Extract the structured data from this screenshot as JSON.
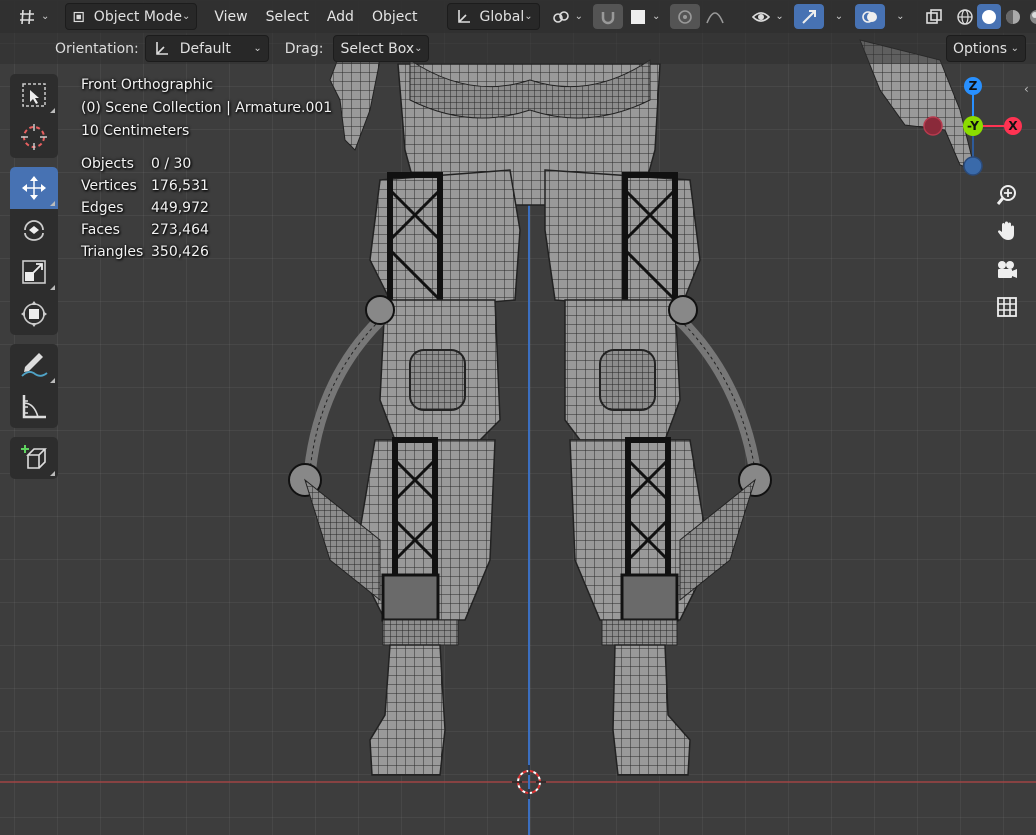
{
  "header": {
    "mode_label": "Object Mode",
    "menus": [
      "View",
      "Select",
      "Add",
      "Object"
    ],
    "transform_orientation": "Global"
  },
  "tool_settings": {
    "orientation_label": "Orientation:",
    "orientation_value": "Default",
    "drag_label": "Drag:",
    "drag_value": "Select Box",
    "options_label": "Options"
  },
  "viewport_info": {
    "view_name": "Front Orthographic",
    "collection": "(0) Scene Collection | Armature.001",
    "grid_scale": "10 Centimeters"
  },
  "stats": [
    {
      "label": "Objects",
      "value": "0 / 30"
    },
    {
      "label": "Vertices",
      "value": "176,531"
    },
    {
      "label": "Edges",
      "value": "449,972"
    },
    {
      "label": "Faces",
      "value": "273,464"
    },
    {
      "label": "Triangles",
      "value": "350,426"
    }
  ],
  "gizmo": {
    "z": "Z",
    "y": "-Y",
    "x": "X"
  },
  "colors": {
    "accent": "#4772b3",
    "axis_x": "#ff3352",
    "axis_y": "#8bdc00",
    "axis_z": "#2890ff",
    "viewport_bg": "#3d3d3d"
  },
  "toolbar_icons": [
    "select-box-icon",
    "cursor-icon",
    "move-icon",
    "rotate-icon",
    "scale-icon",
    "transform-icon",
    "annotate-icon",
    "measure-icon",
    "add-cube-icon"
  ],
  "nav_icons": [
    "zoom-icon",
    "pan-hand-icon",
    "camera-icon",
    "grid-icon"
  ]
}
